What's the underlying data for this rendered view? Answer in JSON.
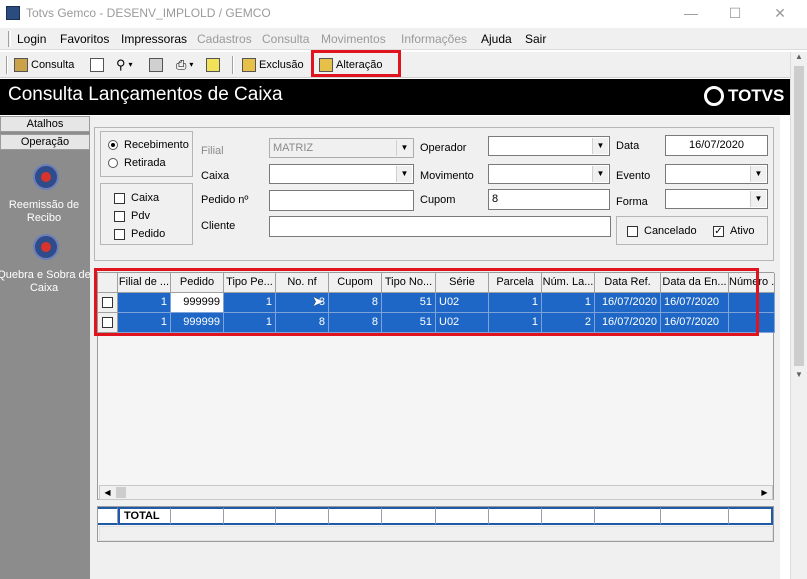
{
  "window": {
    "title": "Totvs Gemco - DESENV_IMPLOLD / GEMCO",
    "controls": [
      "—",
      "☐",
      "✕"
    ]
  },
  "menu": [
    {
      "label": "Login",
      "enabled": true
    },
    {
      "label": "Favoritos",
      "enabled": true
    },
    {
      "label": "Impressoras",
      "enabled": true
    },
    {
      "label": "Cadastros",
      "enabled": false
    },
    {
      "label": "Consulta",
      "enabled": false
    },
    {
      "label": "Movimentos",
      "enabled": false
    },
    {
      "label": "Informações",
      "enabled": false
    },
    {
      "label": "Ajuda",
      "enabled": true
    },
    {
      "label": "Sair",
      "enabled": true
    }
  ],
  "toolbar": {
    "consulta": "Consulta",
    "exclusao": "Exclusão",
    "alteracao": "Alteração",
    "icons": [
      "consulta-icon",
      "new-document-icon",
      "binoculars-icon",
      "export-icon",
      "printer-icon",
      "help-icon"
    ]
  },
  "header": {
    "title": "Consulta Lançamentos de Caixa",
    "brand": "TOTVS"
  },
  "sidebar": {
    "tabs": [
      "Atalhos",
      "Operação"
    ],
    "items": [
      {
        "label": "Reemissão de Recibo",
        "icon": "refresh-icon"
      },
      {
        "label": "Quebra e Sobra de Caixa",
        "icon": "refresh-icon"
      }
    ]
  },
  "form": {
    "tipo": {
      "options": [
        "Recebimento",
        "Retirada"
      ],
      "selected": "Recebimento"
    },
    "origem": [
      {
        "label": "Caixa",
        "checked": false
      },
      {
        "label": "Pdv",
        "checked": false
      },
      {
        "label": "Pedido",
        "checked": false
      }
    ],
    "filial": {
      "label": "Filial",
      "value": "MATRIZ"
    },
    "caixa": {
      "label": "Caixa",
      "value": ""
    },
    "pedido": {
      "label": "Pedido nº",
      "value": ""
    },
    "cliente": {
      "label": "Cliente",
      "value": ""
    },
    "operador": {
      "label": "Operador",
      "value": ""
    },
    "movimento": {
      "label": "Movimento",
      "value": ""
    },
    "cupom": {
      "label": "Cupom",
      "value": "8"
    },
    "data": {
      "label": "Data",
      "value": "16/07/2020"
    },
    "evento": {
      "label": "Evento",
      "value": ""
    },
    "forma": {
      "label": "Forma",
      "value": ""
    },
    "cancelado": {
      "label": "Cancelado",
      "checked": false
    },
    "ativo": {
      "label": "Ativo",
      "checked": true
    }
  },
  "grid": {
    "columns": [
      "",
      "Filial de ...",
      "Pedido",
      "Tipo Pe...",
      "No. nf",
      "Cupom",
      "Tipo No...",
      "Série",
      "Parcela",
      "Núm. La...",
      "Data Ref.",
      "Data da En...",
      "Número ..."
    ],
    "rows": [
      {
        "checked": true,
        "cells": [
          "1",
          "999999",
          "1",
          "8",
          "8",
          "51",
          "U02",
          "1",
          "1",
          "16/07/2020",
          "16/07/2020",
          ""
        ]
      },
      {
        "checked": false,
        "cells": [
          "1",
          "999999",
          "1",
          "8",
          "8",
          "51",
          "U02",
          "1",
          "2",
          "16/07/2020",
          "16/07/2020",
          ""
        ]
      }
    ]
  },
  "totals": {
    "label": "TOTAL"
  }
}
